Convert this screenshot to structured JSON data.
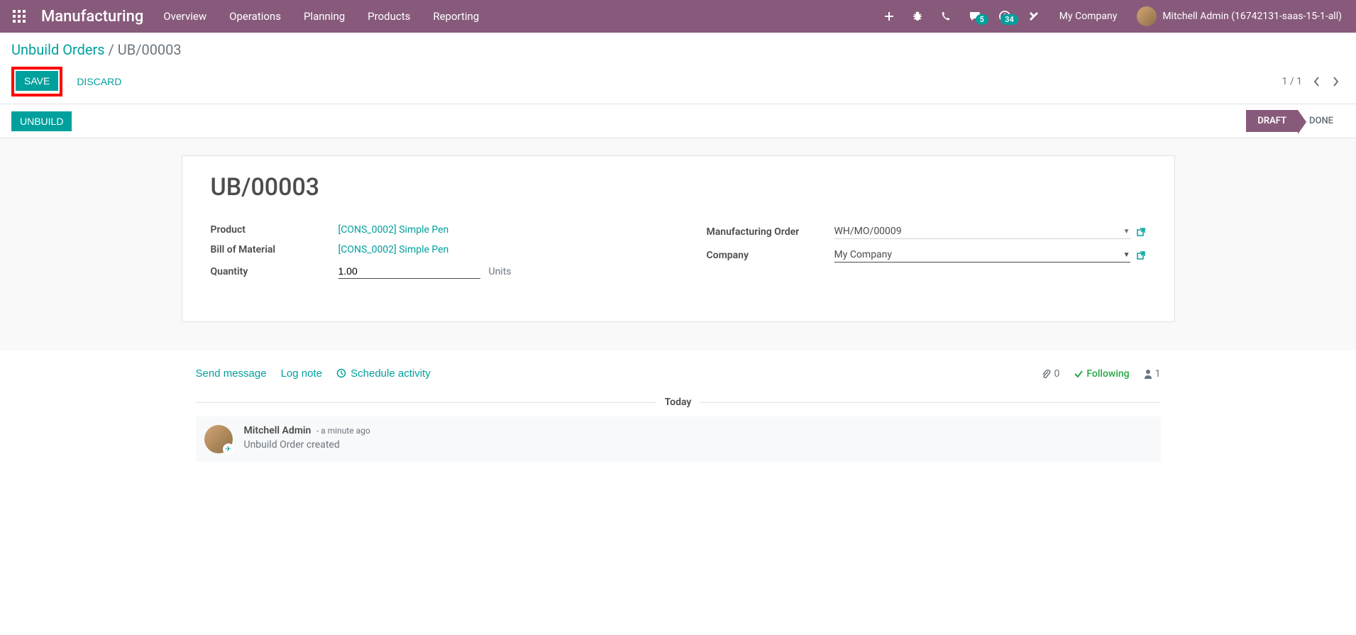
{
  "nav": {
    "brand": "Manufacturing",
    "items": [
      "Overview",
      "Operations",
      "Planning",
      "Products",
      "Reporting"
    ],
    "chat_badge": "5",
    "clock_badge": "34",
    "company": "My Company",
    "user": "Mitchell Admin (16742131-saas-15-1-all)"
  },
  "breadcrumb": {
    "parent": "Unbuild Orders",
    "current": "UB/00003"
  },
  "buttons": {
    "save": "Save",
    "discard": "Discard",
    "unbuild": "Unbuild"
  },
  "pager": {
    "value": "1 / 1"
  },
  "status": {
    "draft": "Draft",
    "done": "Done"
  },
  "record": {
    "title": "UB/00003",
    "labels": {
      "product": "Product",
      "bom": "Bill of Material",
      "quantity": "Quantity",
      "mo": "Manufacturing Order",
      "company": "Company"
    },
    "product": "[CONS_0002] Simple Pen",
    "bom": "[CONS_0002] Simple Pen",
    "quantity": "1.00",
    "quantity_unit": "Units",
    "mo": "WH/MO/00009",
    "company": "My Company"
  },
  "chatter": {
    "send_message": "Send message",
    "log_note": "Log note",
    "schedule": "Schedule activity",
    "attach_count": "0",
    "following": "Following",
    "follower_count": "1",
    "divider": "Today",
    "message": {
      "author": "Mitchell Admin",
      "time": "- a minute ago",
      "body": "Unbuild Order created"
    }
  }
}
